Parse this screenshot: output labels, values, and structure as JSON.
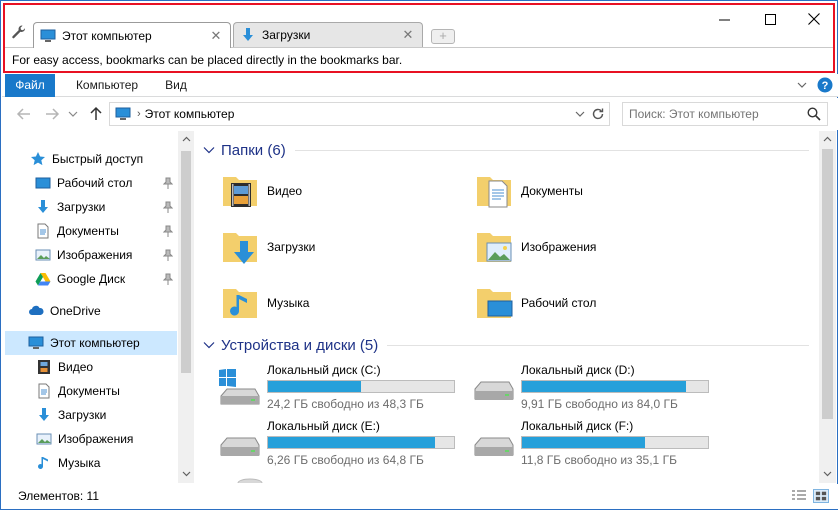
{
  "browser": {
    "tabs": [
      {
        "label": "Этот компьютер",
        "active": true
      },
      {
        "label": "Загрузки",
        "active": false
      }
    ],
    "bookmarks_hint": "For easy access, bookmarks can be placed directly in the bookmarks bar."
  },
  "ribbon": {
    "tabs": [
      "Файл",
      "Компьютер",
      "Вид"
    ]
  },
  "address": {
    "path": "Этот компьютер",
    "search_placeholder": "Поиск: Этот компьютер"
  },
  "nav": {
    "quick_access": "Быстрый доступ",
    "pinned": [
      "Рабочий стол",
      "Загрузки",
      "Документы",
      "Изображения",
      "Google Диск"
    ],
    "onedrive": "OneDrive",
    "this_pc": "Этот компьютер",
    "pc_children": [
      "Видео",
      "Документы",
      "Загрузки",
      "Изображения",
      "Музыка"
    ]
  },
  "content": {
    "folders_header": "Папки (6)",
    "folders": [
      "Видео",
      "Документы",
      "Загрузки",
      "Изображения",
      "Музыка",
      "Рабочий стол"
    ],
    "drives_header": "Устройства и диски (5)",
    "drives": [
      {
        "name": "Локальный диск (C:)",
        "free": "24,2 ГБ свободно из 48,3 ГБ",
        "used_fraction": 0.5
      },
      {
        "name": "Локальный диск (D:)",
        "free": "9,91 ГБ свободно из 84,0 ГБ",
        "used_fraction": 0.88
      },
      {
        "name": "Локальный диск (E:)",
        "free": "6,26 ГБ свободно из 64,8 ГБ",
        "used_fraction": 0.9
      },
      {
        "name": "Локальный диск (F:)",
        "free": "11,8 ГБ свободно из 35,1 ГБ",
        "used_fraction": 0.66
      }
    ]
  },
  "status": {
    "items": "Элементов: 11"
  },
  "colors": {
    "accent": "#1979ca",
    "bar": "#26a0da",
    "selected": "#cce8ff",
    "highlight_border": "#e81123"
  }
}
